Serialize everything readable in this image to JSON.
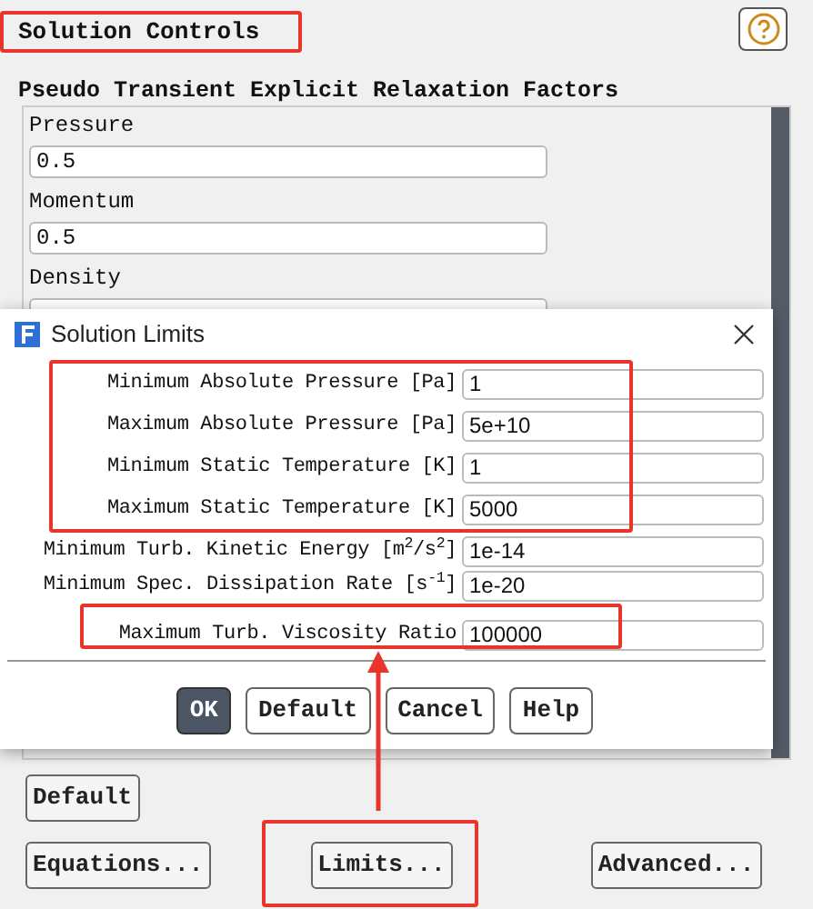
{
  "header": {
    "title": "Solution Controls"
  },
  "section_title": "Pseudo Transient Explicit Relaxation Factors",
  "factors": [
    {
      "label": "Pressure",
      "value": "0.5"
    },
    {
      "label": "Momentum",
      "value": "0.5"
    },
    {
      "label": "Density"
    }
  ],
  "dialog": {
    "title": "Solution Limits",
    "fields": [
      {
        "label": "Minimum Absolute Pressure [Pa]",
        "value": "1"
      },
      {
        "label": "Maximum Absolute Pressure [Pa]",
        "value": "5e+10"
      },
      {
        "label": "Minimum Static Temperature [K]",
        "value": "1"
      },
      {
        "label": "Maximum Static Temperature [K]",
        "value": "5000"
      },
      {
        "label": "Minimum Turb. Kinetic Energy [m$^{2}$/s$^{2}$]",
        "value": "1e-14"
      },
      {
        "label": "Minimum Spec. Dissipation Rate [s$^{-1}$]",
        "value": "1e-20"
      },
      {
        "label": "Maximum Turb. Viscosity Ratio",
        "value": "100000"
      }
    ],
    "buttons": [
      {
        "label": "OK",
        "default": true
      },
      {
        "label": "Default",
        "default": false
      },
      {
        "label": "Cancel",
        "default": false
      },
      {
        "label": "Help",
        "default": false
      }
    ]
  },
  "buttons": [
    {
      "label": "Default"
    },
    {
      "label": "Equations..."
    },
    {
      "label": "Limits..."
    },
    {
      "label": "Advanced..."
    }
  ]
}
